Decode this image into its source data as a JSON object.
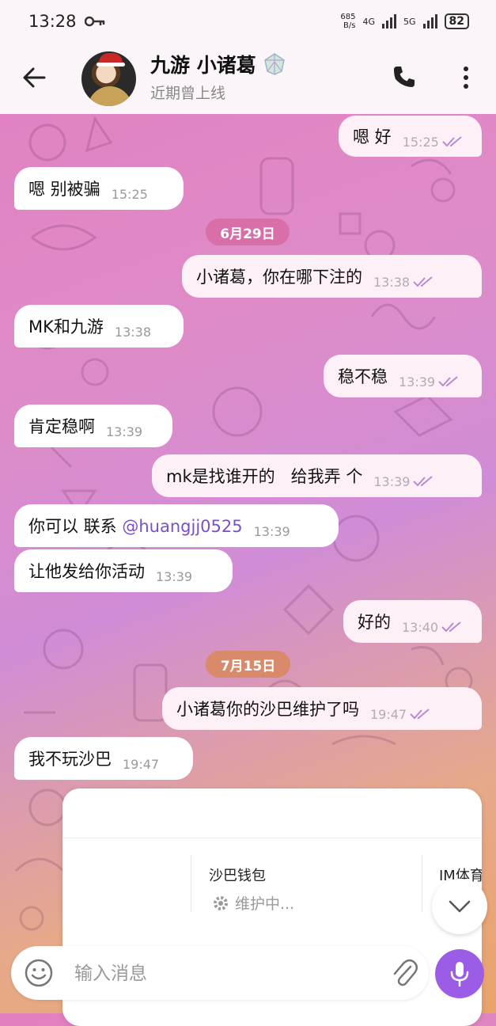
{
  "status_bar": {
    "time": "13:28",
    "net_speed_value": "685",
    "net_speed_unit": "B/s",
    "sim1": "4G",
    "sim2": "5G",
    "battery": "82"
  },
  "header": {
    "contact_name": "九游 小诸葛",
    "presence": "近期曾上线"
  },
  "messages": [
    {
      "dir": "out",
      "text": "嗯 好",
      "time": "15:25"
    },
    {
      "dir": "in",
      "text": "嗯  别被骗",
      "time": "15:25"
    },
    {
      "dir": "out",
      "text": "小诸葛，你在哪下注的",
      "time": "13:38"
    },
    {
      "dir": "in",
      "text": "MK和九游",
      "time": "13:38"
    },
    {
      "dir": "out",
      "text": "稳不稳",
      "time": "13:39"
    },
    {
      "dir": "in",
      "text": "肯定稳啊",
      "time": "13:39"
    },
    {
      "dir": "out",
      "text": "mk是找谁开的   给我弄 个",
      "time": "13:39"
    },
    {
      "dir": "in",
      "text_prefix": "你可以 联系 ",
      "mention": "@huangjj0525",
      "time": "13:39"
    },
    {
      "dir": "in",
      "text": "让他发给你活动",
      "time": "13:39"
    },
    {
      "dir": "out",
      "text": "好的",
      "time": "13:40"
    },
    {
      "dir": "out",
      "text": "小诸葛你的沙巴维护了吗",
      "time": "19:47"
    },
    {
      "dir": "in",
      "text": "我不玩沙巴",
      "time": "19:47"
    }
  ],
  "date_separators": [
    "6月29日",
    "7月15日"
  ],
  "shared_card": {
    "wallet_label": "沙巴钱包",
    "wallet_status": "维护中...",
    "im_label": "IM体育"
  },
  "composer": {
    "placeholder": "输入消息"
  },
  "colors": {
    "accent": "#9b5de5",
    "date_pill_1": "#d96fa8",
    "date_pill_2": "#d98a6a",
    "check": "#b98ad8"
  }
}
